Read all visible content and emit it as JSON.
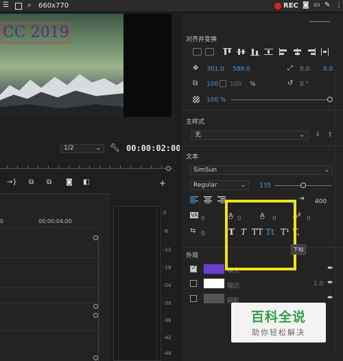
{
  "toolbar": {
    "resolution": "660x770",
    "rec_label": "REC"
  },
  "preview": {
    "title_text": "CC 2019",
    "zoom_value": "1/2",
    "timecode": "00:00:02:00"
  },
  "timeline": {
    "ruler_start": "0",
    "ruler_mark": "00:00:04:00",
    "meter_db": [
      "0",
      "-6",
      "-12",
      "-18",
      "-24",
      "-30",
      "-36",
      "-42",
      "-48"
    ]
  },
  "panel": {
    "align_transform_title": "对齐并变换",
    "position_x": "301.0",
    "position_y": "589.0",
    "anchor_x": "0.0",
    "anchor_y": "0.0",
    "scale_w": "100",
    "scale_h": "100",
    "percent_unit": "%",
    "rotation": "0 °",
    "opacity": "100 %",
    "opacity_fraction": 1.0,
    "master_style_title": "主样式",
    "master_style_value": "无",
    "text_title": "文本",
    "font_family": "SimSun",
    "font_style": "Regular",
    "font_size": "135",
    "font_size_fraction": 0.5,
    "tab_stop_value": "400",
    "tracking": "0",
    "kerning": "0",
    "leading": "0",
    "baseline": "0",
    "tsume": "0",
    "text_style_buttons": [
      "T",
      "T",
      "TT",
      "Tt",
      "T¹",
      "T,"
    ],
    "appearance_title": "外观",
    "fill_label": "填充",
    "stroke_label": "描边",
    "stroke_width": "1.0",
    "shadow_label": "阴影",
    "tooltip_text": "下标",
    "fill_color": "#6a3fd0",
    "stroke_color": "#ffffff",
    "shadow_color": "#555555",
    "highlight_color": "#f2e318",
    "accent_color": "#4a9be0"
  },
  "watermark": {
    "main": "百科全说",
    "sub": "助你轻松解决"
  }
}
